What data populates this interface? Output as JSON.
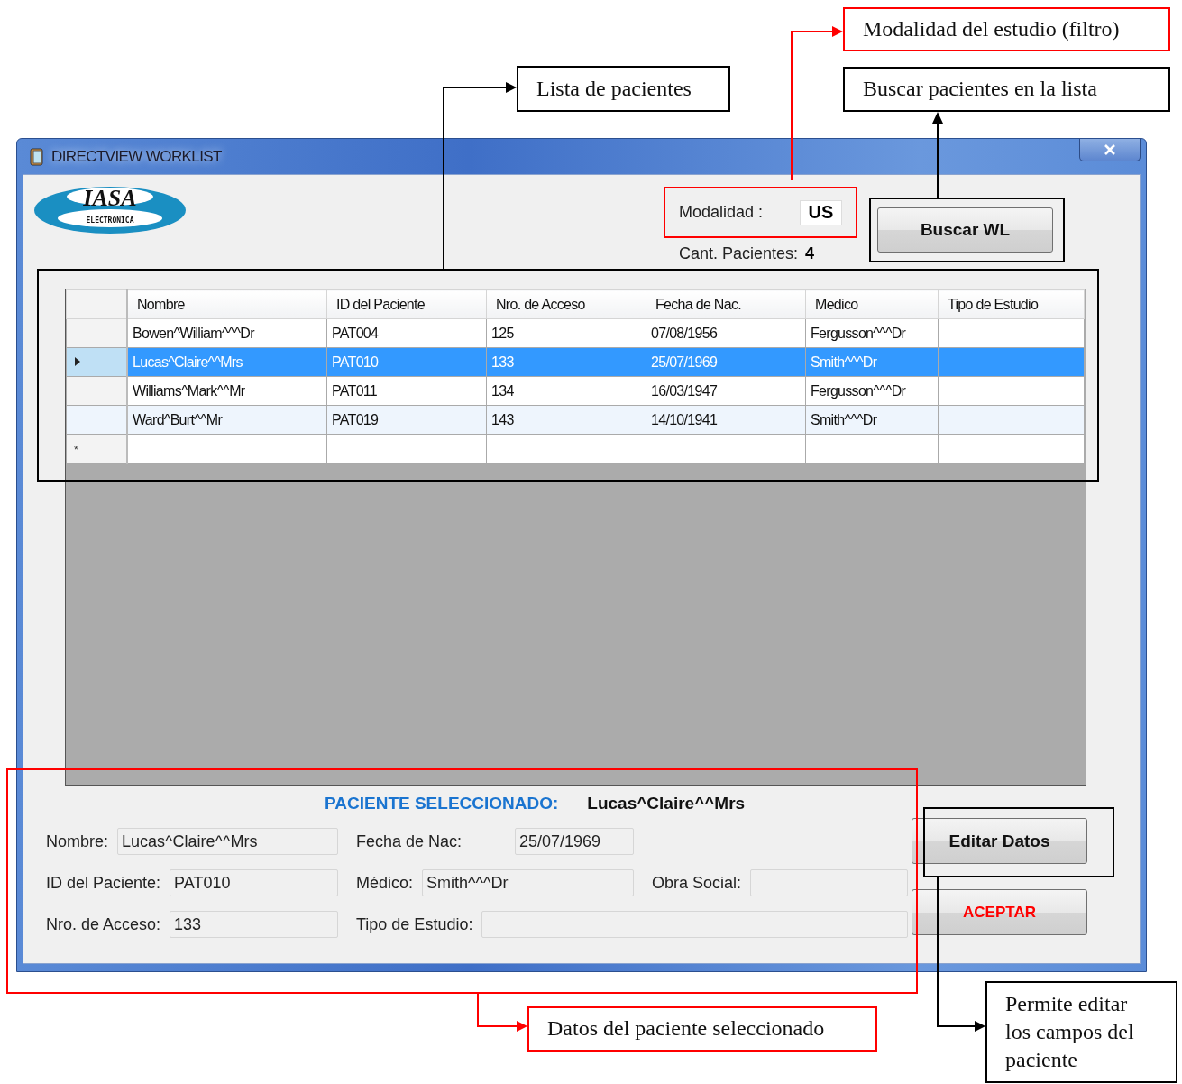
{
  "window": {
    "title": "DIRECTVIEW WORKLIST"
  },
  "logo": {
    "name": "IASA",
    "subtitle": "ELECTRONICA"
  },
  "modality": {
    "label": "Modalidad :",
    "value": "US"
  },
  "patient_count": {
    "label": "Cant. Pacientes:",
    "value": "4"
  },
  "search_button": "Buscar WL",
  "table": {
    "columns": [
      "Nombre",
      "ID del Paciente",
      "Nro. de Acceso",
      "Fecha de Nac.",
      "Medico",
      "Tipo de Estudio"
    ],
    "rows": [
      {
        "cells": [
          "Bowen^William^^^Dr",
          "PAT004",
          "125",
          "07/08/1956",
          "Fergusson^^^Dr"
        ],
        "selected": false
      },
      {
        "cells": [
          "Lucas^Claire^^Mrs",
          "PAT010",
          "133",
          "25/07/1969",
          "Smith^^^Dr"
        ],
        "selected": true
      },
      {
        "cells": [
          "Williams^Mark^^Mr",
          "PAT011",
          "134",
          "16/03/1947",
          "Fergusson^^^Dr"
        ],
        "selected": false
      },
      {
        "cells": [
          "Ward^Burt^^Mr",
          "PAT019",
          "143",
          "14/10/1941",
          "Smith^^^Dr"
        ],
        "selected": false
      }
    ],
    "new_row_marker": "*"
  },
  "selected_patient": {
    "heading": "PACIENTE SELECCIONADO:",
    "name": "Lucas^Claire^^Mrs"
  },
  "form_rows": [
    {
      "fields": [
        {
          "label": "Nombre:",
          "value": "Lucas^Claire^^Mrs"
        },
        {
          "label": "Fecha de Nac:",
          "value": "25/07/1969"
        }
      ]
    },
    {
      "fields": [
        {
          "label": "ID del Paciente:",
          "value": "PAT010"
        },
        {
          "label": "Médico:",
          "value": "Smith^^^Dr"
        },
        {
          "label": "Obra Social:"
        }
      ]
    },
    {
      "fields": [
        {
          "label": "Nro. de Acceso:",
          "value": "133"
        },
        {
          "label": "Tipo de Estudio:"
        }
      ]
    }
  ],
  "buttons": [
    {
      "label": "Editar Datos",
      "kind": "normal"
    },
    {
      "label": "ACEPTAR",
      "kind": "accept"
    }
  ],
  "annotations": [
    {
      "text": "Modalidad del estudio (filtro)",
      "color": "#ff0000"
    },
    {
      "text": "Lista de pacientes",
      "color": "#000000"
    },
    {
      "text": "Buscar pacientes en la lista",
      "color": "#000000"
    },
    {
      "text": "Datos del paciente seleccionado",
      "color": "#ff0000"
    },
    {
      "text": "Permite editar los campos del paciente",
      "color": "#000000"
    }
  ]
}
